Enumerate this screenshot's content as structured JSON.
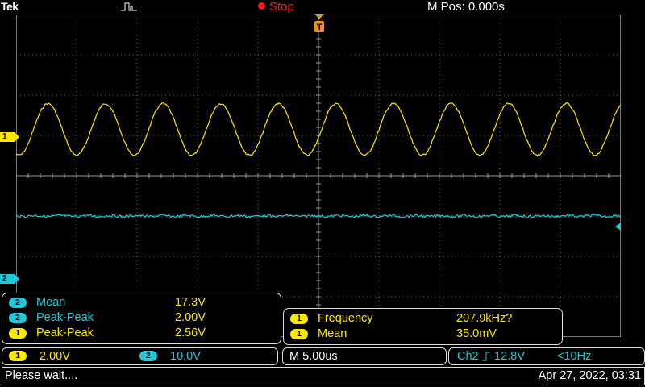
{
  "header": {
    "brand": "Tek",
    "status": "Stop",
    "mpos": "M Pos: 0.000s"
  },
  "colors": {
    "ch1": "#ffe800",
    "ch2": "#20c8d8",
    "stop": "#ff1a1a",
    "trigger": "#ff8a1a"
  },
  "markers": {
    "ch1": "1",
    "ch2": "2",
    "trigger": "T"
  },
  "measurements_left": [
    {
      "channel": "2",
      "label": "Mean",
      "value": "17.3V"
    },
    {
      "channel": "2",
      "label": "Peak-Peak",
      "value": "2.00V"
    },
    {
      "channel": "1",
      "label": "Peak-Peak",
      "value": "2.56V"
    }
  ],
  "measurements_right": [
    {
      "channel": "1",
      "label": "Frequency",
      "value": "207.9kHz?"
    },
    {
      "channel": "1",
      "label": "Mean",
      "value": "35.0mV"
    }
  ],
  "settings": {
    "ch1_badge": "1",
    "ch1_scale": "2.00V",
    "ch2_badge": "2",
    "ch2_scale": "10.0V",
    "timebase": "M 5.00us",
    "trigger_source": "Ch2",
    "trigger_slope_icon": "rising-edge-icon",
    "trigger_level": "12.8V",
    "trigger_freq": "<10Hz"
  },
  "footer": {
    "message": "Please wait....",
    "datetime": "Apr 27, 2022, 03:31"
  },
  "waveforms": {
    "ch1": {
      "type": "sine",
      "cycles": 10.5,
      "peak_to_peak_div": 1.28,
      "center_div": 1.15
    },
    "ch2": {
      "type": "flat-noise",
      "level_div": -1.0
    }
  }
}
